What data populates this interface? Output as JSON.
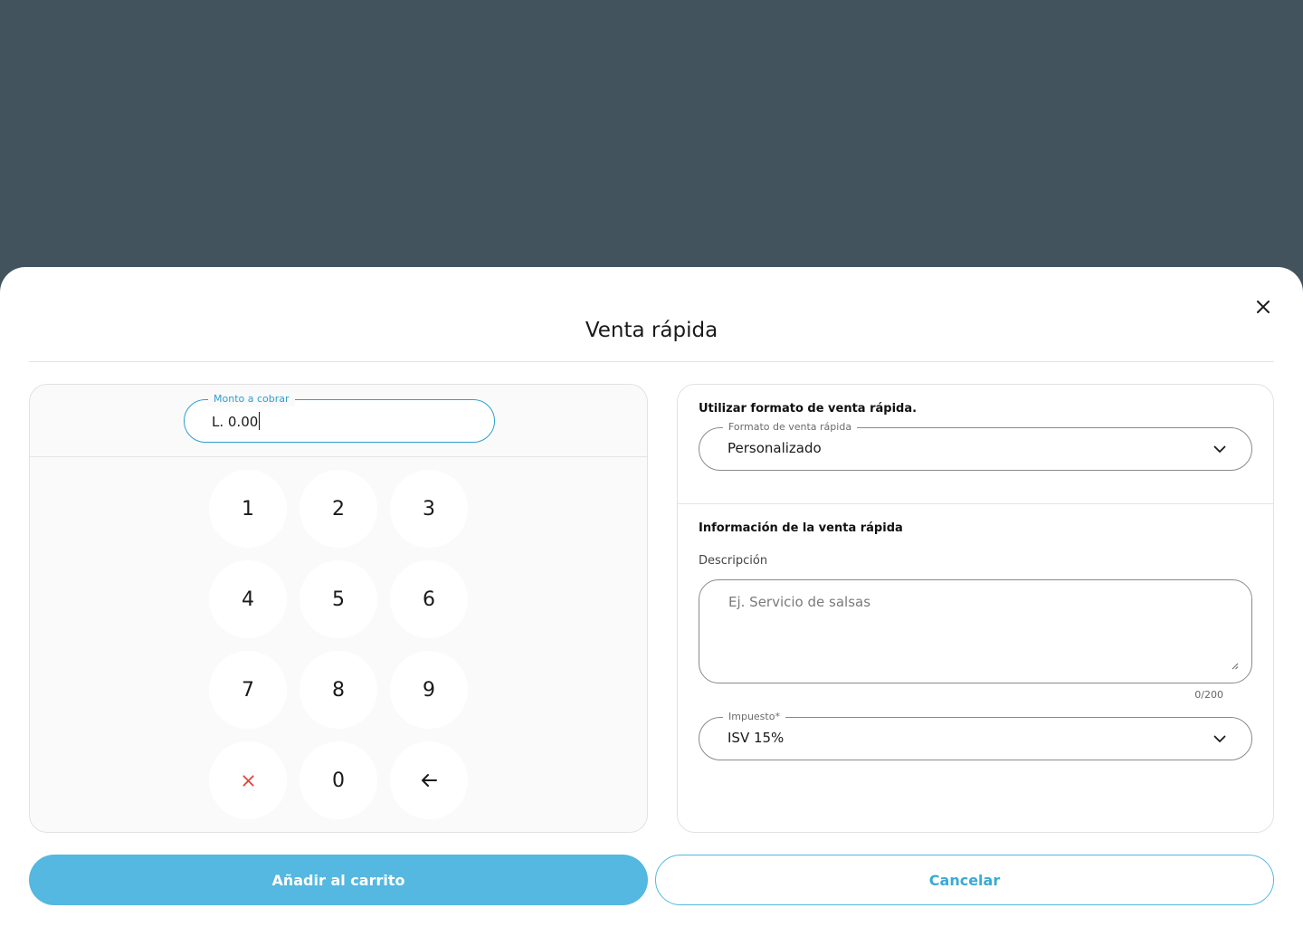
{
  "modal": {
    "title": "Venta rápida"
  },
  "amount": {
    "label": "Monto a cobrar",
    "value": "L. 0.00"
  },
  "keypad": {
    "keys": [
      "1",
      "2",
      "3",
      "4",
      "5",
      "6",
      "7",
      "8",
      "9",
      "×",
      "0",
      "←"
    ]
  },
  "format_section": {
    "heading": "Utilizar formato de venta rápida.",
    "select_label": "Formato de venta rápida",
    "select_value": "Personalizado"
  },
  "info_section": {
    "heading": "Información de la venta rápida",
    "description_label": "Descripción",
    "description_placeholder": "Ej. Servicio de salsas",
    "char_count": "0/200",
    "tax_label": "Impuesto*",
    "tax_value": "ISV 15%"
  },
  "actions": {
    "add_to_cart": "Añadir al carrito",
    "cancel": "Cancelar"
  },
  "colors": {
    "backdrop": "#43535e",
    "accent": "#54b8e0",
    "focus": "#2d9fd0",
    "clear": "#e0463c"
  }
}
